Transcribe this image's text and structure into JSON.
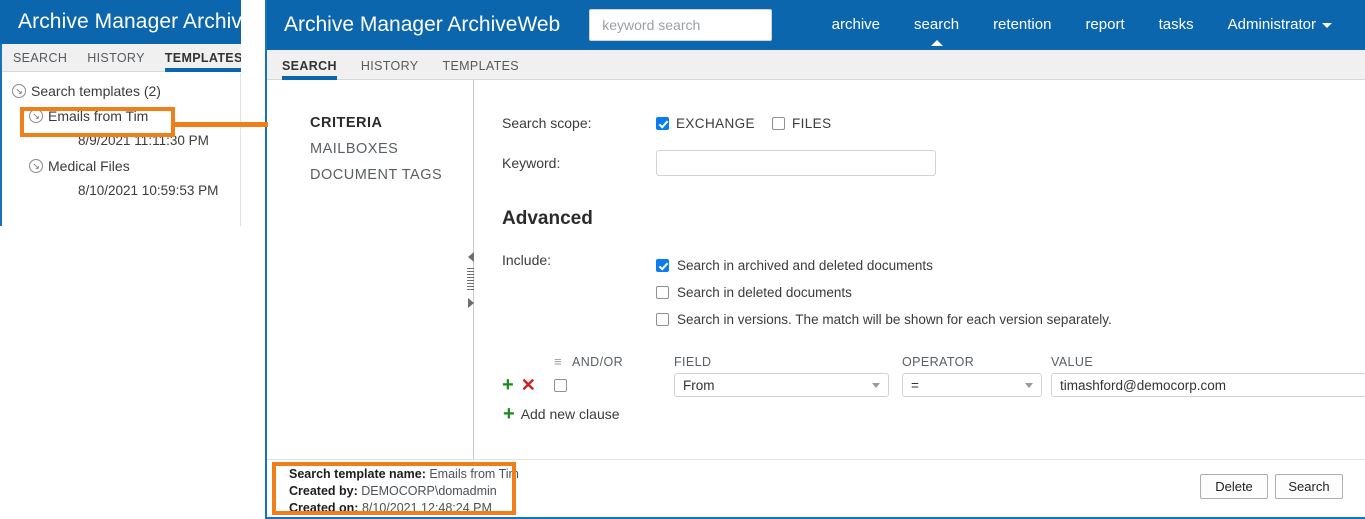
{
  "back_window": {
    "brand_title": "Archive Manager ArchiveW",
    "tabs": [
      {
        "label": "SEARCH",
        "active": false
      },
      {
        "label": "HISTORY",
        "active": false
      },
      {
        "label": "TEMPLATES",
        "active": true
      }
    ],
    "tree": {
      "root_label": "Search templates (2)",
      "nodes": [
        {
          "label": "Emails from Tim",
          "date": "8/9/2021 11:11:30 PM"
        },
        {
          "label": "Medical Files",
          "date": "8/10/2021 10:59:53 PM"
        }
      ]
    }
  },
  "front_window": {
    "brand_title": "Archive Manager ArchiveWeb",
    "search": {
      "placeholder": "keyword search",
      "value": ""
    },
    "topnav": [
      {
        "label": "archive",
        "active": false
      },
      {
        "label": "search",
        "active": true
      },
      {
        "label": "retention",
        "active": false
      },
      {
        "label": "report",
        "active": false
      },
      {
        "label": "tasks",
        "active": false
      },
      {
        "label": "Administrator",
        "active": false,
        "has_caret": true
      }
    ],
    "tabs": [
      {
        "label": "SEARCH",
        "active": true
      },
      {
        "label": "HISTORY",
        "active": false
      },
      {
        "label": "TEMPLATES",
        "active": false
      }
    ],
    "criteria_nav": [
      {
        "label": "CRITERIA",
        "active": true
      },
      {
        "label": "MAILBOXES",
        "active": false
      },
      {
        "label": "DOCUMENT TAGS",
        "active": false
      }
    ],
    "form": {
      "scope_label": "Search scope:",
      "scope_options": [
        {
          "label": "EXCHANGE",
          "checked": true
        },
        {
          "label": "FILES",
          "checked": false
        }
      ],
      "keyword_label": "Keyword:",
      "keyword_value": "",
      "keyword_placeholder": "",
      "advanced_title": "Advanced",
      "include_label": "Include:",
      "include_options": [
        {
          "label": "Search in archived and deleted documents",
          "checked": true
        },
        {
          "label": "Search in deleted documents",
          "checked": false
        },
        {
          "label": "Search in versions. The match will be shown for each version separately.",
          "checked": false
        }
      ],
      "clause_headers": {
        "andor": "AND/OR",
        "field": "FIELD",
        "operator": "OPERATOR",
        "value": "VALUE"
      },
      "clause": {
        "andor_checked": false,
        "field": "From",
        "operator": "=",
        "value": "timashford@democorp.com"
      },
      "add_clause_label": "Add new clause"
    },
    "footer": {
      "template_name_label": "Search template name:",
      "template_name_value": "Emails from Tim",
      "created_by_label": "Created by:",
      "created_by_value": "DEMOCORP\\domadmin",
      "created_on_label": "Created on:",
      "created_on_value": "8/10/2021 12:48:24 PM",
      "delete_label": "Delete",
      "search_label": "Search"
    }
  },
  "icons": {
    "tree_expand": "⌄",
    "plus": "+",
    "remove": "✕",
    "list": "☰"
  },
  "colors": {
    "brand_blue": "#0b66ae",
    "accent_blue": "#1573be",
    "checkbox_blue": "#0b7cf0",
    "annotation_orange": "#f07f1a",
    "add_green": "#1a8a1a",
    "remove_red": "#cc2222"
  }
}
